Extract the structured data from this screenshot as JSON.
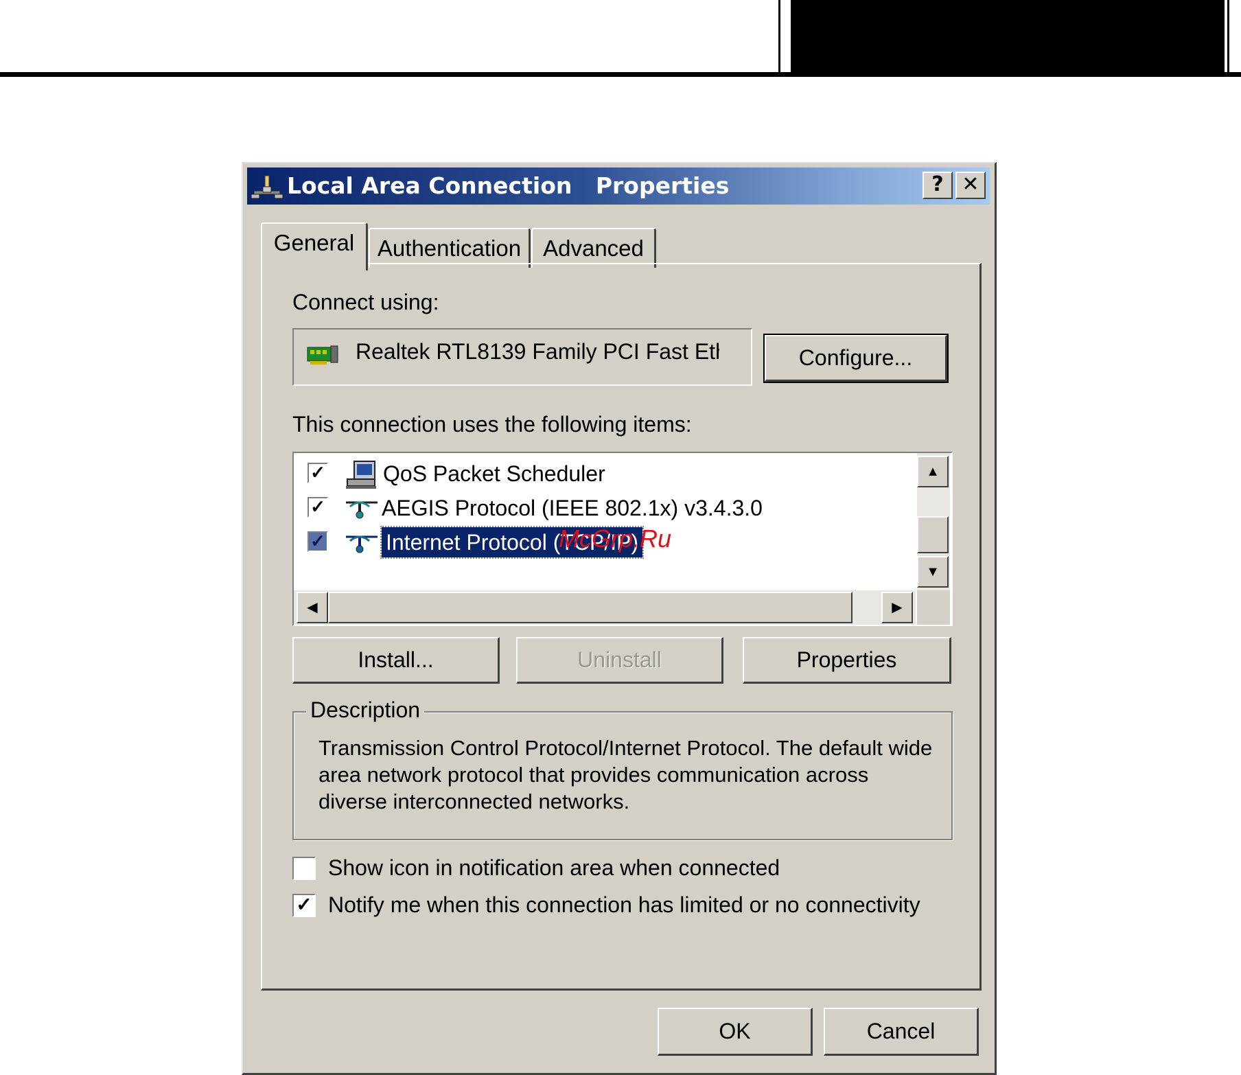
{
  "dialog": {
    "title_name": "Local Area Connection",
    "title_suffix": "Properties",
    "help_button": "?",
    "close_button": "✕"
  },
  "tabs": [
    {
      "label": "General",
      "active": true
    },
    {
      "label": "Authentication",
      "active": false
    },
    {
      "label": "Advanced",
      "active": false
    }
  ],
  "connect_using": {
    "label": "Connect using:",
    "adapter": "Realtek RTL8139 Family PCI Fast Eth",
    "configure_button": "Configure..."
  },
  "items_section": {
    "label": "This connection uses the following items:",
    "items": [
      {
        "label": "QoS Packet Scheduler",
        "checked": true,
        "icon": "scheduler-icon"
      },
      {
        "label": "AEGIS Protocol (IEEE 802.1x) v3.4.3.0",
        "checked": true,
        "icon": "protocol-icon"
      },
      {
        "label": "Internet Protocol (TCP/IP)",
        "checked": true,
        "selected": true,
        "icon": "protocol-icon"
      }
    ]
  },
  "buttons": {
    "install": "Install...",
    "uninstall": "Uninstall",
    "properties": "Properties"
  },
  "description": {
    "legend": "Description",
    "text": "Transmission Control Protocol/Internet Protocol. The default wide area network protocol that provides communication across diverse interconnected networks."
  },
  "options": {
    "show_icon": {
      "label": "Show icon in notification area when connected",
      "checked": false
    },
    "notify": {
      "label": "Notify me when this connection has limited or no connectivity",
      "checked": true
    }
  },
  "footer": {
    "ok": "OK",
    "cancel": "Cancel"
  },
  "watermark": "McGrp.Ru",
  "colors": {
    "titlebar_start": "#0a246a",
    "titlebar_end": "#a6caf0",
    "face": "#d4d0c8",
    "selection": "#0a246a",
    "watermark": "#e0101a"
  }
}
